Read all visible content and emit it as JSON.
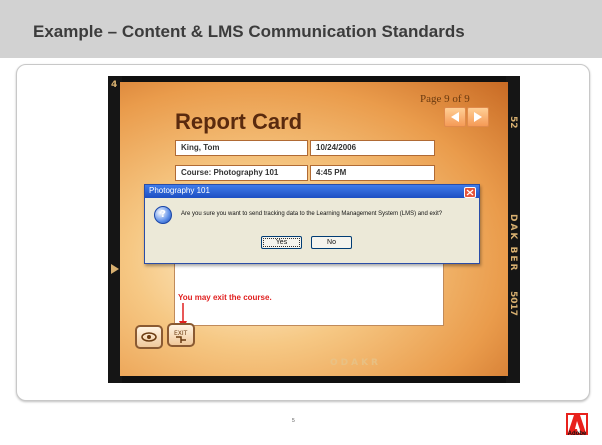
{
  "slide": {
    "title": "Example – Content & LMS Communication Standards",
    "page_number": "5",
    "logo_text": "Adobe"
  },
  "film_marks": {
    "left_top": "4",
    "right_top": "52",
    "right_mid": "DAK BER",
    "right_low": "5017",
    "bottom": "ODAKR"
  },
  "course": {
    "page_indicator": "Page 9 of 9",
    "report_title": "Report Card",
    "student_name": "King, Tom",
    "date": "10/24/2006",
    "course_name": "Course: Photography 101",
    "time": "4:45 PM",
    "exit_message": "You may exit the course."
  },
  "dialog": {
    "title": "Photography 101",
    "message": "Are you sure you want to send tracking data to the Learning Management System (LMS) and exit?",
    "yes_label": "Yes",
    "no_label": "No"
  },
  "colors": {
    "header_bg": "#d2d2d2",
    "title_text": "#3c3c3c",
    "exit_message": "#e02020",
    "dialog_titlebar": "#1c4ec2"
  }
}
